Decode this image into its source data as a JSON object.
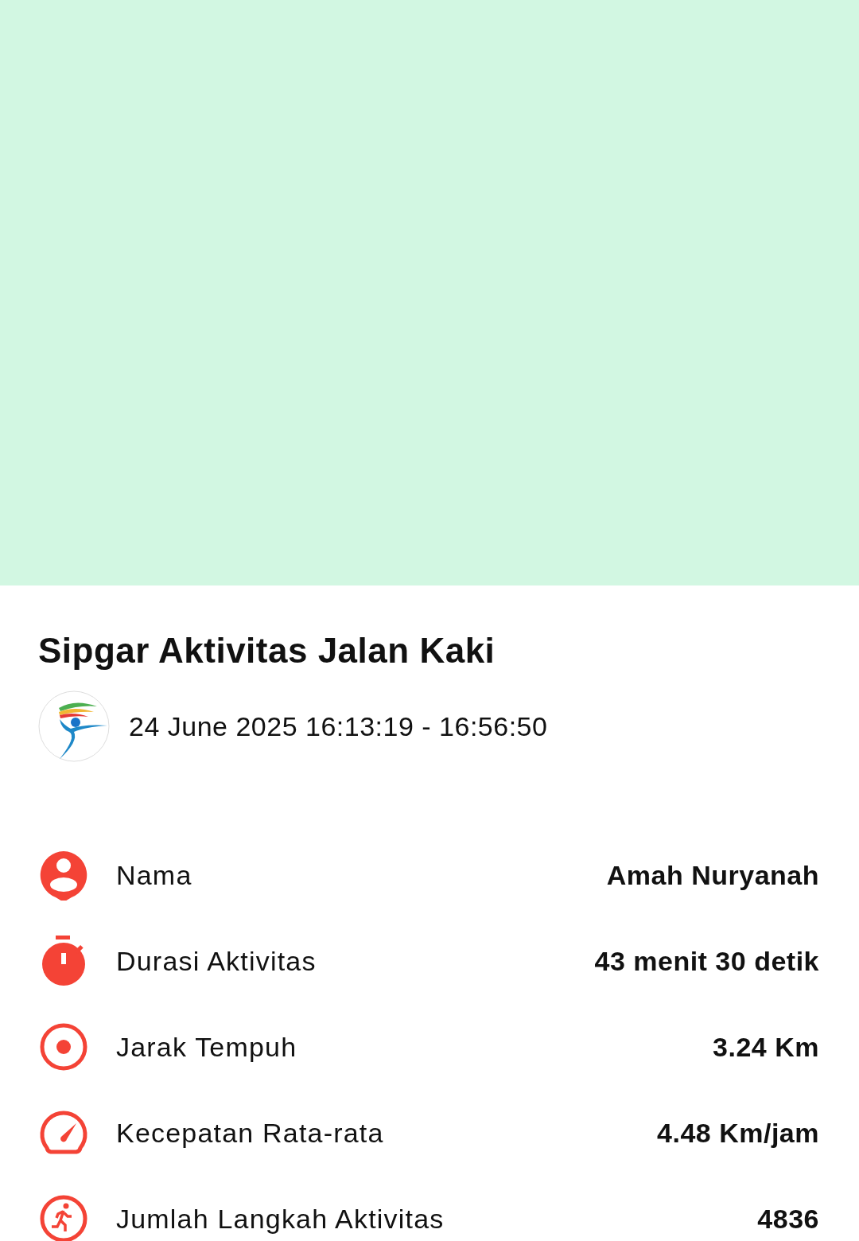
{
  "title": "Sipgar Aktivitas Jalan Kaki",
  "datetime": "24 June 2025 16:13:19 - 16:56:50",
  "rows": [
    {
      "kind": "person",
      "label": "Nama",
      "value": "Amah Nuryanah"
    },
    {
      "kind": "stopwatch",
      "label": "Durasi Aktivitas",
      "value": "43 menit 30 detik"
    },
    {
      "kind": "target",
      "label": "Jarak Tempuh",
      "value": "3.24 Km"
    },
    {
      "kind": "speed",
      "label": "Kecepatan Rata-rata",
      "value": "4.48 Km/jam"
    },
    {
      "kind": "walk",
      "label": "Jumlah Langkah Aktivitas",
      "value": "4836"
    }
  ]
}
